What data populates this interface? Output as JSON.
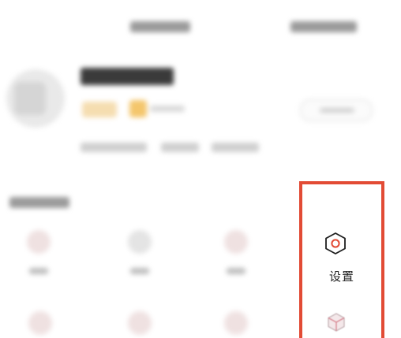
{
  "settings": {
    "label": "设置",
    "icon": "settings-hexagon-icon",
    "accent": "#e24b35"
  },
  "more_item": {
    "icon": "cube-icon"
  }
}
